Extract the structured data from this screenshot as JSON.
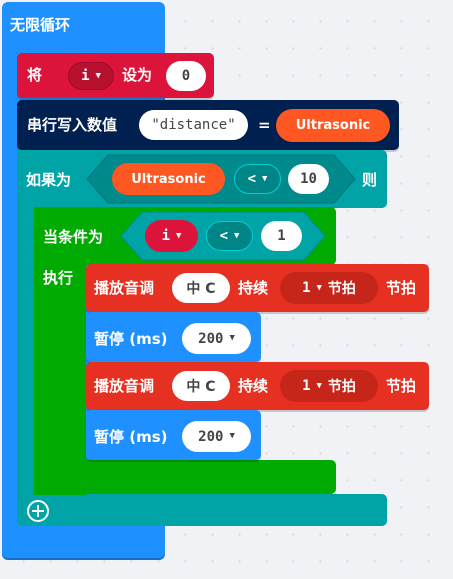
{
  "forever": {
    "label": "无限循环"
  },
  "set_block": {
    "label": "将",
    "variable": "i",
    "label2": "设为",
    "value": "0"
  },
  "serial_block": {
    "label": "串行写入数值",
    "key": "\"distance\"",
    "equals": "=",
    "value_block": "Ultrasonic"
  },
  "if_block": {
    "label": "如果为",
    "left": "Ultrasonic",
    "operator": "<",
    "right": "10",
    "then_label": "则"
  },
  "while_block": {
    "label": "当条件为",
    "left": "i",
    "operator": "<",
    "right": "1",
    "do_label": "执行"
  },
  "tone1": {
    "label": "播放音调",
    "note": "中 C",
    "duration_label": "持续",
    "beats": "1",
    "beat_unit": "节拍",
    "tail": "节拍"
  },
  "pause1": {
    "label": "暂停 (ms)",
    "value": "200"
  },
  "tone2": {
    "label": "播放音调",
    "note": "中 C",
    "duration_label": "持续",
    "beats": "1",
    "beat_unit": "节拍",
    "tail": "节拍"
  },
  "pause2": {
    "label": "暂停 (ms)",
    "value": "200"
  },
  "add_else": {
    "icon": "plus-circle-icon"
  },
  "colors": {
    "forever": "#1e90ff",
    "variables": "#dc143c",
    "serial": "#002050",
    "logic": "#00a4a6",
    "loops": "#00aa00",
    "music": "#e63022",
    "basic": "#1e90ff",
    "sensor": "#ff5722"
  }
}
